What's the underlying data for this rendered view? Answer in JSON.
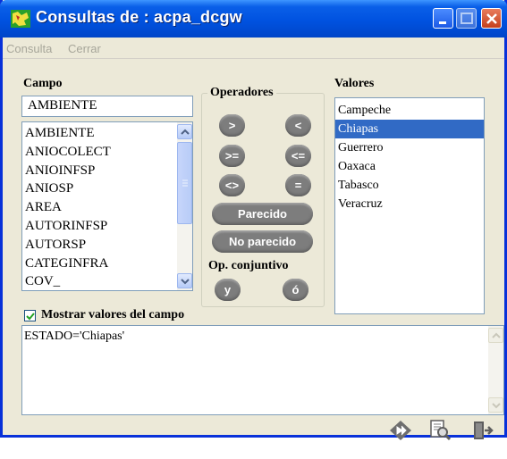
{
  "window": {
    "title": "Consultas de : acpa_dcgw",
    "app_icon": "map-app-icon"
  },
  "menu": {
    "items": [
      "Consulta",
      "Cerrar"
    ]
  },
  "campo": {
    "label": "Campo",
    "selected_value": "AMBIENTE",
    "items": [
      "AMBIENTE",
      "ANIOCOLECT",
      "ANIOINFSP",
      "ANIOSP",
      "AREA",
      "AUTORINFSP",
      "AUTORSP",
      "CATEGINFRA",
      "COV_"
    ]
  },
  "operadores": {
    "label": "Operadores",
    "buttons": [
      ">",
      "<",
      ">=",
      "<=",
      "<>",
      "="
    ],
    "parecido": "Parecido",
    "no_parecido": "No parecido",
    "conj_label": "Op. conjuntivo",
    "and": "y",
    "or": "ó"
  },
  "valores": {
    "label": "Valores",
    "items": [
      "Campeche",
      "Chiapas",
      "Guerrero",
      "Oaxaca",
      "Tabasco",
      "Veracruz"
    ],
    "selected": "Chiapas"
  },
  "mostrar": {
    "label": "Mostrar valores del campo",
    "checked": true
  },
  "query": {
    "text": "ESTADO='Chiapas'"
  },
  "actions": [
    "run-query-icon",
    "zoom-query-icon",
    "exit-icon"
  ],
  "colors": {
    "title_bar": "#0052e0",
    "selection": "#316ac5",
    "operator_button": "#7d7d7d",
    "window_bg": "#ece9d8"
  }
}
